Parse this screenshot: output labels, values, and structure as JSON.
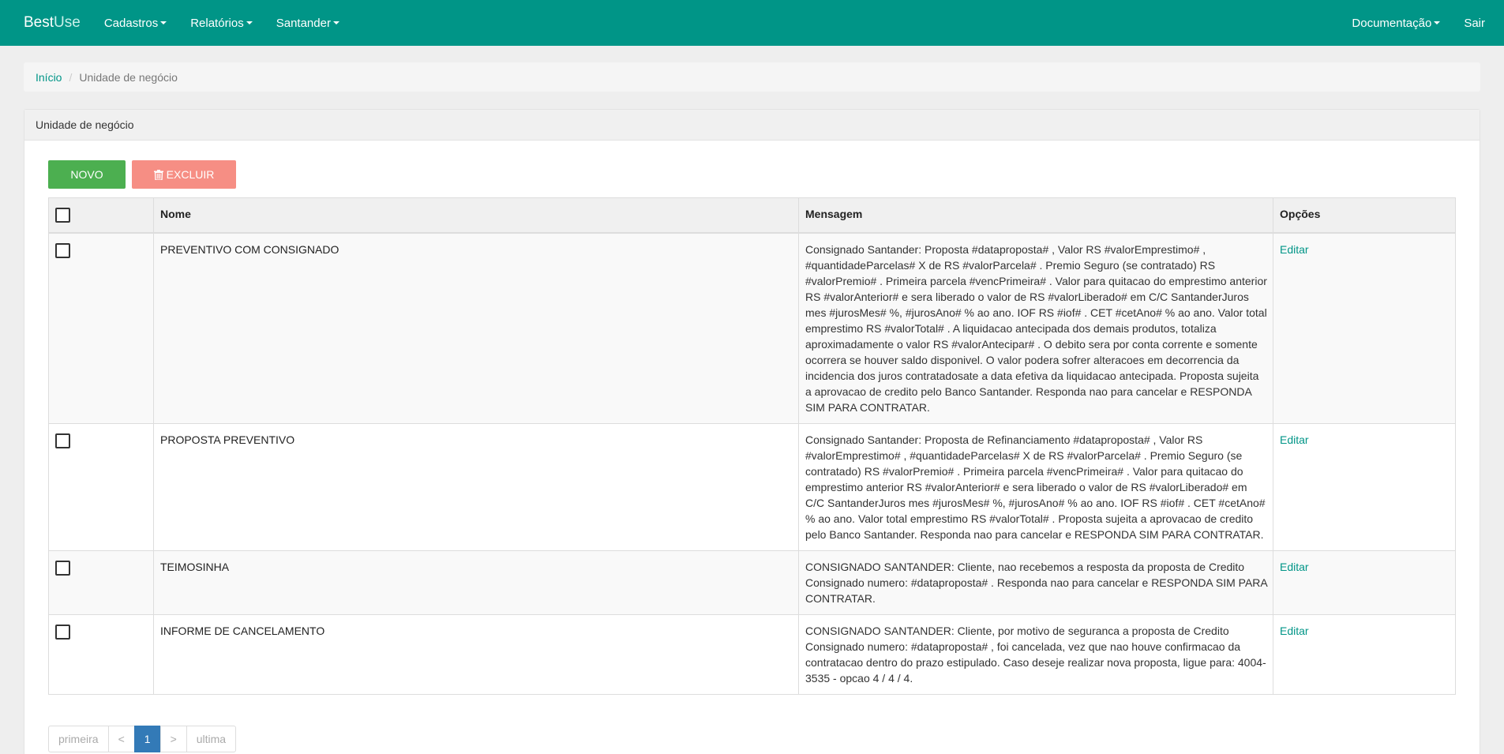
{
  "navbar": {
    "brand_part1": "Best",
    "brand_part2": "Use",
    "menu": [
      {
        "label": "Cadastros"
      },
      {
        "label": "Relatórios"
      },
      {
        "label": "Santander"
      }
    ],
    "right": [
      {
        "label": "Documentação"
      },
      {
        "label": "Sair"
      }
    ]
  },
  "breadcrumb": {
    "home": "Início",
    "current": "Unidade de negócio"
  },
  "panel": {
    "title": "Unidade de negócio",
    "btn_novo": "NOVO",
    "btn_excluir": "EXCLUIR"
  },
  "table": {
    "headers": [
      "",
      "Nome",
      "Mensagem",
      "Opções"
    ],
    "rows": [
      {
        "nome": "PREVENTIVO COM CONSIGNADO",
        "mensagem": "Consignado Santander: Proposta #dataproposta# , Valor RS #valorEmprestimo# , #quantidadeParcelas# X de RS #valorParcela# . Premio Seguro (se contratado) RS #valorPremio# . Primeira parcela #vencPrimeira# . Valor para quitacao do emprestimo anterior RS #valorAnterior# e sera liberado o valor de RS #valorLiberado# em C/C SantanderJuros mes #jurosMes# %, #jurosAno# % ao ano. IOF RS #iof# . CET #cetAno# % ao ano. Valor total emprestimo RS #valorTotal# . A liquidacao antecipada dos demais produtos, totaliza aproximadamente o valor RS #valorAntecipar# . O debito sera por conta corrente e somente ocorrera se houver saldo disponivel. O valor podera sofrer alteracoes em decorrencia da incidencia dos juros contratadosate a data efetiva da liquidacao antecipada. Proposta sujeita a aprovacao de credito pelo Banco Santander. Responda nao para cancelar e RESPONDA SIM PARA CONTRATAR.",
        "opcao": "Editar"
      },
      {
        "nome": "PROPOSTA PREVENTIVO",
        "mensagem": "Consignado Santander: Proposta de Refinanciamento #dataproposta# , Valor RS #valorEmprestimo# , #quantidadeParcelas# X de RS #valorParcela# . Premio Seguro (se contratado) RS #valorPremio# . Primeira parcela #vencPrimeira# . Valor para quitacao do emprestimo anterior RS #valorAnterior# e sera liberado o valor de RS #valorLiberado# em C/C SantanderJuros mes #jurosMes# %, #jurosAno# % ao ano. IOF RS #iof# . CET #cetAno# % ao ano. Valor total emprestimo RS #valorTotal# . Proposta sujeita a aprovacao de credito pelo Banco Santander. Responda nao para cancelar e RESPONDA SIM PARA CONTRATAR.",
        "opcao": "Editar"
      },
      {
        "nome": "TEIMOSINHA",
        "mensagem": "CONSIGNADO SANTANDER: Cliente, nao recebemos a resposta da proposta de Credito Consignado numero: #dataproposta# . Responda nao para cancelar e RESPONDA SIM PARA CONTRATAR.",
        "opcao": "Editar"
      },
      {
        "nome": "INFORME DE CANCELAMENTO",
        "mensagem": "CONSIGNADO SANTANDER: Cliente, por motivo de seguranca a proposta de Credito Consignado numero: #dataproposta# , foi cancelada, vez que nao houve confirmacao da contratacao dentro do prazo estipulado. Caso deseje realizar nova proposta, ligue para: 4004-3535 - opcao 4 / 4 / 4.",
        "opcao": "Editar"
      }
    ]
  },
  "pagination": {
    "first": "primeira",
    "prev": "<",
    "current": "1",
    "next": ">",
    "last": "ultima"
  },
  "colors": {
    "navbar": "#009587",
    "link": "#009587",
    "btn_novo": "#4caf50",
    "btn_excluir": "#f68e84",
    "page_active": "#337ab7"
  }
}
